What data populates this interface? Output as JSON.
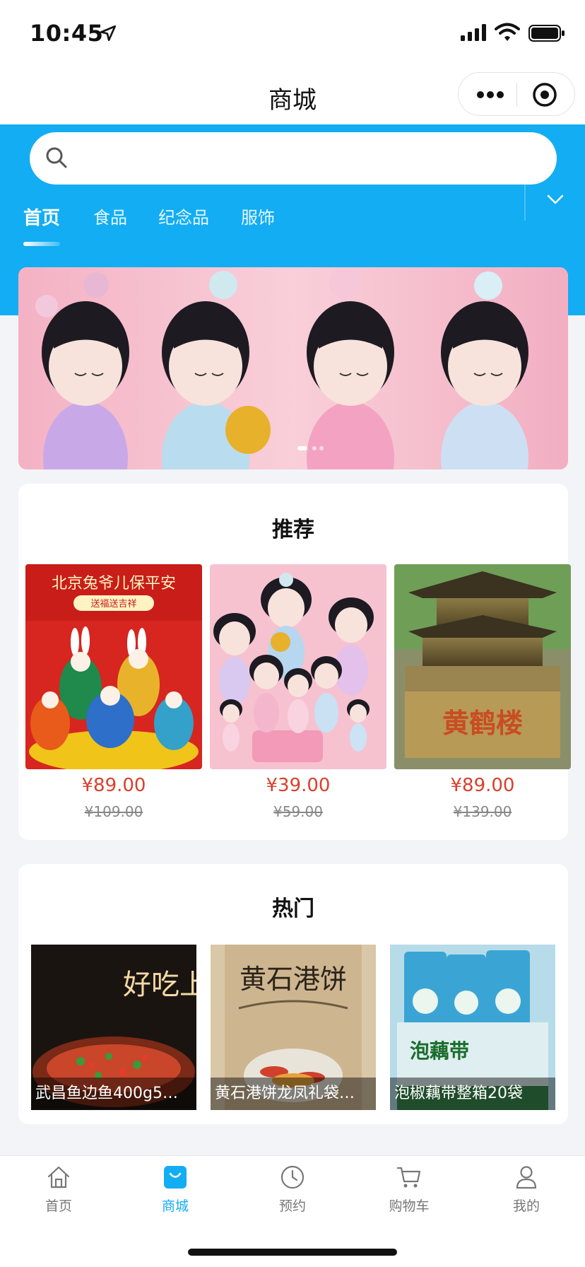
{
  "status_bar": {
    "time": "10:45"
  },
  "nav": {
    "title": "商城"
  },
  "search": {
    "placeholder": ""
  },
  "tabs": [
    {
      "label": "首页",
      "active": true
    },
    {
      "label": "食品",
      "active": false
    },
    {
      "label": "纪念品",
      "active": false
    },
    {
      "label": "服饰",
      "active": false
    }
  ],
  "sections": {
    "recommend": {
      "title": "推荐",
      "items": [
        {
          "image_text": "北京兔爷儿保平安",
          "image_sub": "送福送吉祥",
          "price": "¥89.00",
          "old_price": "¥109.00"
        },
        {
          "price": "¥39.00",
          "old_price": "¥59.00"
        },
        {
          "image_text": "黄鹤楼",
          "price": "¥89.00",
          "old_price": "¥139.00"
        }
      ]
    },
    "hot": {
      "title": "热门",
      "items": [
        {
          "label": "武昌鱼边鱼400g5…",
          "image_text": "好吃上瘾"
        },
        {
          "label": "黄石港饼龙凤礼袋…",
          "image_text": "黄石港饼"
        },
        {
          "label": "泡椒藕带整箱20袋",
          "image_text": "泡藕带"
        }
      ]
    }
  },
  "tabbar": [
    {
      "label": "首页",
      "icon": "home-icon",
      "active": false
    },
    {
      "label": "商城",
      "icon": "shop-bag-icon",
      "active": true
    },
    {
      "label": "预约",
      "icon": "clock-icon",
      "active": false
    },
    {
      "label": "购物车",
      "icon": "cart-icon",
      "active": false
    },
    {
      "label": "我的",
      "icon": "user-icon",
      "active": false
    }
  ],
  "colors": {
    "brand": "#12adf3",
    "price": "#d9402b",
    "active_tab": "#12adf3"
  }
}
